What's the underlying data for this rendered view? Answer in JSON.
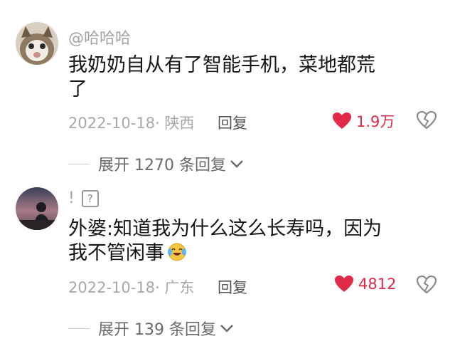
{
  "comments": [
    {
      "username": "@哈哈哈",
      "text_line1": "我奶奶自从有了智能手机，菜地都荒",
      "text_line2": "了",
      "date": "2022-10-18",
      "location": "· 陕西",
      "reply_label": "回复",
      "like_count": "1.9万",
      "expand_label": "展开 1270 条回复",
      "avatar_icon": "cat-avatar"
    },
    {
      "username": "!",
      "username_badge": "?",
      "text_line1": "外婆:知道我为什么这么长寿吗，因为",
      "text_line2": "我不管闲事",
      "date": "2022-10-18",
      "location": "· 广东",
      "reply_label": "回复",
      "like_count": "4812",
      "expand_label": "展开 139 条回复",
      "avatar_icon": "silhouette-avatar",
      "emoji": "laughing-crying-emoji"
    }
  ],
  "colors": {
    "like_red": "#e12a4a",
    "meta_gray": "#a8a8a8",
    "text_dark": "#161616"
  }
}
